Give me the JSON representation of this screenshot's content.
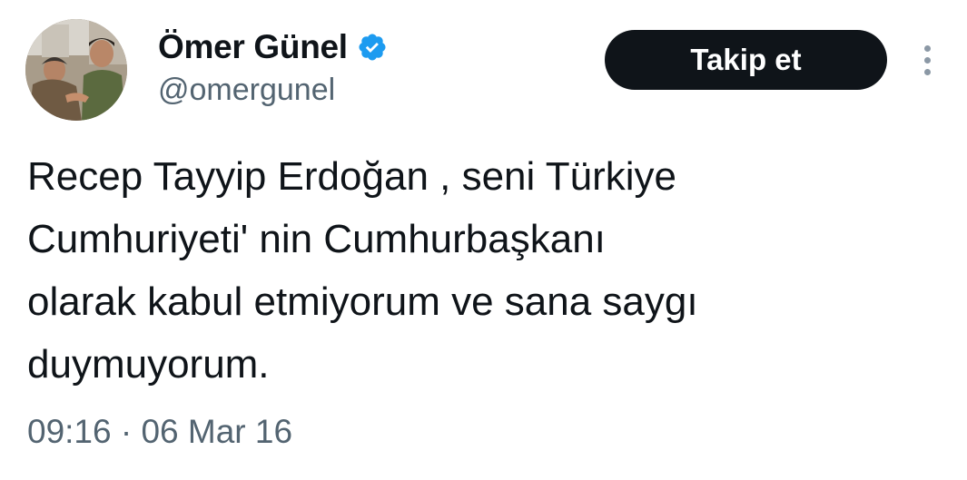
{
  "author": {
    "display_name": "Ömer Günel",
    "handle": "@omergunel",
    "verified": true,
    "verified_color": "#1d9bf0"
  },
  "actions": {
    "follow_label": "Takip et",
    "more_icon": "more-vertical-icon"
  },
  "tweet": {
    "text": "Recep Tayyip Erdoğan , seni Türkiye\nCumhuriyeti' nin Cumhurbaşkanı\nolarak kabul etmiyorum ve sana saygı\nduymuyorum.",
    "timestamp": "09:16 · 06 Mar 16"
  },
  "colors": {
    "text": "#0f1419",
    "muted": "#536471",
    "button_bg": "#0f1419",
    "button_text": "#ffffff"
  }
}
